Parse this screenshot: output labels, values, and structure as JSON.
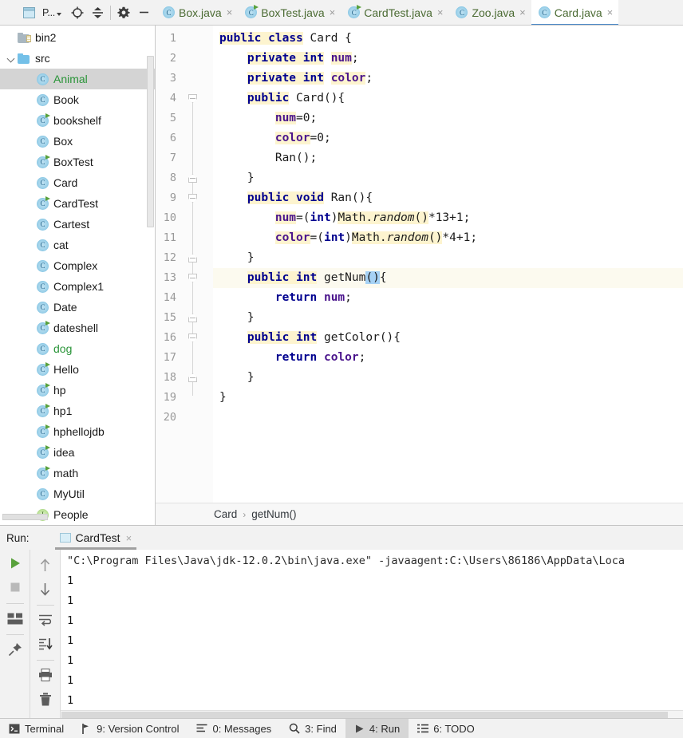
{
  "toolbar": {
    "project_label": "P...",
    "icons": [
      "project-window-icon",
      "locate-target-icon",
      "collapse-all-icon",
      "settings-gear-icon",
      "hide-panel-icon"
    ]
  },
  "tabs": [
    {
      "label": "Box.java",
      "runnable": false,
      "active": false
    },
    {
      "label": "BoxTest.java",
      "runnable": true,
      "active": false
    },
    {
      "label": "CardTest.java",
      "runnable": true,
      "active": false
    },
    {
      "label": "Zoo.java",
      "runnable": false,
      "active": false
    },
    {
      "label": "Card.java",
      "runnable": false,
      "active": true
    }
  ],
  "tab_close_glyph": "×",
  "sidebar": {
    "items": [
      {
        "label": "bin2",
        "type": "folder-grey",
        "level": 0,
        "selected": false,
        "green": false,
        "expanded": false
      },
      {
        "label": "src",
        "type": "folder",
        "level": 0,
        "selected": false,
        "green": false,
        "expanded": true
      },
      {
        "label": "Animal",
        "type": "class",
        "level": 1,
        "selected": true,
        "green": true,
        "runnable": false
      },
      {
        "label": "Book",
        "type": "class",
        "level": 1,
        "selected": false,
        "green": false,
        "runnable": false
      },
      {
        "label": "bookshelf",
        "type": "class",
        "level": 1,
        "selected": false,
        "green": false,
        "runnable": true
      },
      {
        "label": "Box",
        "type": "class",
        "level": 1,
        "selected": false,
        "green": false,
        "runnable": false
      },
      {
        "label": "BoxTest",
        "type": "class",
        "level": 1,
        "selected": false,
        "green": false,
        "runnable": true
      },
      {
        "label": "Card",
        "type": "class",
        "level": 1,
        "selected": false,
        "green": false,
        "runnable": false
      },
      {
        "label": "CardTest",
        "type": "class",
        "level": 1,
        "selected": false,
        "green": false,
        "runnable": true
      },
      {
        "label": "Cartest",
        "type": "class",
        "level": 1,
        "selected": false,
        "green": false,
        "runnable": false
      },
      {
        "label": "cat",
        "type": "class",
        "level": 1,
        "selected": false,
        "green": false,
        "runnable": false
      },
      {
        "label": "Complex",
        "type": "class",
        "level": 1,
        "selected": false,
        "green": false,
        "runnable": false
      },
      {
        "label": "Complex1",
        "type": "class",
        "level": 1,
        "selected": false,
        "green": false,
        "runnable": false
      },
      {
        "label": "Date",
        "type": "class",
        "level": 1,
        "selected": false,
        "green": false,
        "runnable": false
      },
      {
        "label": "dateshell",
        "type": "class",
        "level": 1,
        "selected": false,
        "green": false,
        "runnable": true
      },
      {
        "label": "dog",
        "type": "class",
        "level": 1,
        "selected": false,
        "green": true,
        "runnable": false
      },
      {
        "label": "Hello",
        "type": "class",
        "level": 1,
        "selected": false,
        "green": false,
        "runnable": true
      },
      {
        "label": "hp",
        "type": "class",
        "level": 1,
        "selected": false,
        "green": false,
        "runnable": true
      },
      {
        "label": "hp1",
        "type": "class",
        "level": 1,
        "selected": false,
        "green": false,
        "runnable": true
      },
      {
        "label": "hphellojdb",
        "type": "class",
        "level": 1,
        "selected": false,
        "green": false,
        "runnable": true
      },
      {
        "label": "idea",
        "type": "class",
        "level": 1,
        "selected": false,
        "green": false,
        "runnable": true
      },
      {
        "label": "math",
        "type": "class",
        "level": 1,
        "selected": false,
        "green": false,
        "runnable": true
      },
      {
        "label": "MyUtil",
        "type": "class",
        "level": 1,
        "selected": false,
        "green": false,
        "runnable": false
      },
      {
        "label": "People",
        "type": "interface",
        "level": 1,
        "selected": false,
        "green": false,
        "runnable": false
      }
    ],
    "class_glyph": "C",
    "interface_glyph": "I"
  },
  "editor": {
    "file": "Card.java",
    "line_count": 20,
    "caret_line": 13,
    "lines": [
      {
        "n": 1,
        "tokens": [
          {
            "t": "public",
            "c": "kw"
          },
          {
            "t": " ",
            "c": "hl"
          },
          {
            "t": "class",
            "c": "kw"
          },
          {
            "t": " Card {",
            "c": "plain"
          }
        ]
      },
      {
        "n": 2,
        "tokens": [
          {
            "t": "    ",
            "c": "plain"
          },
          {
            "t": "private",
            "c": "kw"
          },
          {
            "t": " ",
            "c": "hl"
          },
          {
            "t": "int",
            "c": "kw"
          },
          {
            "t": " ",
            "c": "plain"
          },
          {
            "t": "num",
            "c": "fld"
          },
          {
            "t": ";",
            "c": "plain"
          }
        ]
      },
      {
        "n": 3,
        "tokens": [
          {
            "t": "    ",
            "c": "plain"
          },
          {
            "t": "private",
            "c": "kw"
          },
          {
            "t": " ",
            "c": "hl"
          },
          {
            "t": "int",
            "c": "kw"
          },
          {
            "t": " ",
            "c": "plain"
          },
          {
            "t": "color",
            "c": "fld"
          },
          {
            "t": ";",
            "c": "plain"
          }
        ]
      },
      {
        "n": 4,
        "tokens": [
          {
            "t": "    ",
            "c": "plain"
          },
          {
            "t": "public",
            "c": "kw"
          },
          {
            "t": " ",
            "c": "plain"
          },
          {
            "t": "Card(){",
            "c": "plain"
          }
        ]
      },
      {
        "n": 5,
        "tokens": [
          {
            "t": "        ",
            "c": "plain"
          },
          {
            "t": "num",
            "c": "fld"
          },
          {
            "t": "=0;",
            "c": "plain"
          }
        ]
      },
      {
        "n": 6,
        "tokens": [
          {
            "t": "        ",
            "c": "plain"
          },
          {
            "t": "color",
            "c": "fld"
          },
          {
            "t": "=0;",
            "c": "plain"
          }
        ]
      },
      {
        "n": 7,
        "tokens": [
          {
            "t": "        Ran();",
            "c": "plain"
          }
        ]
      },
      {
        "n": 8,
        "tokens": [
          {
            "t": "    }",
            "c": "plain"
          }
        ]
      },
      {
        "n": 9,
        "tokens": [
          {
            "t": "    ",
            "c": "plain"
          },
          {
            "t": "public",
            "c": "kw"
          },
          {
            "t": " ",
            "c": "hl"
          },
          {
            "t": "void",
            "c": "kw"
          },
          {
            "t": " Ran(){",
            "c": "plain"
          }
        ]
      },
      {
        "n": 10,
        "tokens": [
          {
            "t": "        ",
            "c": "plain"
          },
          {
            "t": "num",
            "c": "fld"
          },
          {
            "t": "=(",
            "c": "plain"
          },
          {
            "t": "int",
            "c": "kwp"
          },
          {
            "t": ")",
            "c": "plain"
          },
          {
            "t": "Math.",
            "c": "hl"
          },
          {
            "t": "random",
            "c": "stat-hl"
          },
          {
            "t": "()",
            "c": "hl"
          },
          {
            "t": "*13+1;",
            "c": "plain"
          }
        ]
      },
      {
        "n": 11,
        "tokens": [
          {
            "t": "        ",
            "c": "plain"
          },
          {
            "t": "color",
            "c": "fld"
          },
          {
            "t": "=(",
            "c": "plain"
          },
          {
            "t": "int",
            "c": "kwp"
          },
          {
            "t": ")",
            "c": "plain"
          },
          {
            "t": "Math.",
            "c": "hl"
          },
          {
            "t": "random",
            "c": "stat-hl"
          },
          {
            "t": "()",
            "c": "hl"
          },
          {
            "t": "*4+1;",
            "c": "plain"
          }
        ]
      },
      {
        "n": 12,
        "tokens": [
          {
            "t": "    }",
            "c": "plain"
          }
        ]
      },
      {
        "n": 13,
        "tokens": [
          {
            "t": "    ",
            "c": "plain"
          },
          {
            "t": "public",
            "c": "kw"
          },
          {
            "t": " ",
            "c": "hl"
          },
          {
            "t": "int",
            "c": "kw"
          },
          {
            "t": " getNum",
            "c": "plain"
          },
          {
            "t": "()",
            "c": "selblue"
          },
          {
            "t": "{",
            "c": "plain"
          }
        ]
      },
      {
        "n": 14,
        "tokens": [
          {
            "t": "        ",
            "c": "plain"
          },
          {
            "t": "return",
            "c": "kwp"
          },
          {
            "t": " ",
            "c": "plain"
          },
          {
            "t": "num",
            "c": "fldp"
          },
          {
            "t": ";",
            "c": "plain"
          }
        ]
      },
      {
        "n": 15,
        "tokens": [
          {
            "t": "    }",
            "c": "plain"
          }
        ]
      },
      {
        "n": 16,
        "tokens": [
          {
            "t": "    ",
            "c": "plain"
          },
          {
            "t": "public",
            "c": "kw"
          },
          {
            "t": " ",
            "c": "hl"
          },
          {
            "t": "int",
            "c": "kw"
          },
          {
            "t": " getColor(){",
            "c": "plain"
          }
        ]
      },
      {
        "n": 17,
        "tokens": [
          {
            "t": "        ",
            "c": "plain"
          },
          {
            "t": "return",
            "c": "kwp"
          },
          {
            "t": " ",
            "c": "plain"
          },
          {
            "t": "color",
            "c": "fldp"
          },
          {
            "t": ";",
            "c": "plain"
          }
        ]
      },
      {
        "n": 18,
        "tokens": [
          {
            "t": "    }",
            "c": "plain"
          }
        ]
      },
      {
        "n": 19,
        "tokens": [
          {
            "t": "}",
            "c": "plain"
          }
        ]
      },
      {
        "n": 20,
        "tokens": []
      }
    ],
    "folds": [
      {
        "line": 4,
        "kind": "chev"
      },
      {
        "line": 8,
        "kind": "minus"
      },
      {
        "line": 9,
        "kind": "chev"
      },
      {
        "line": 12,
        "kind": "minus"
      },
      {
        "line": 13,
        "kind": "chev"
      },
      {
        "line": 15,
        "kind": "minus"
      },
      {
        "line": 16,
        "kind": "chev"
      },
      {
        "line": 18,
        "kind": "minus"
      }
    ]
  },
  "breadcrumb": {
    "parts": [
      "Card",
      "getNum()"
    ],
    "separator": "›"
  },
  "run_panel": {
    "title": "Run:",
    "tab_label": "CardTest",
    "tab_close_glyph": "×",
    "left_icons": [
      "rerun-play-icon",
      "stop-icon",
      "layout-toggle-icon",
      "pin-tab-icon"
    ],
    "right_icons": [
      "up-arrow-icon",
      "down-arrow-icon",
      "soft-wrap-icon",
      "scroll-to-end-icon",
      "print-icon",
      "clear-all-icon"
    ],
    "console_lines": [
      "\"C:\\Program Files\\Java\\jdk-12.0.2\\bin\\java.exe\" -javaagent:C:\\Users\\86186\\AppData\\Loca",
      "1",
      "1",
      "1",
      "1",
      "1",
      "1",
      "1"
    ]
  },
  "status_bar": {
    "items": [
      {
        "label": "Terminal",
        "icon": "terminal-icon",
        "active": false
      },
      {
        "label": "9: Version Control",
        "icon": "branch-icon",
        "active": false
      },
      {
        "label": "0: Messages",
        "icon": "messages-icon",
        "active": false
      },
      {
        "label": "3: Find",
        "icon": "search-icon",
        "active": false
      },
      {
        "label": "4: Run",
        "icon": "play-icon",
        "active": true
      },
      {
        "label": "6: TODO",
        "icon": "todo-list-icon",
        "active": false
      }
    ]
  },
  "colors": {
    "accent_blue": "#4a88c7",
    "tab_text_green": "#4b6b33",
    "vcs_green": "#299438",
    "keyword_blue": "#00008f",
    "field_purple": "#4a148c",
    "highlight_yellow": "#fdf4cf",
    "selection_blue": "#a6d2f5",
    "chrome_grey": "#f2f2f2"
  }
}
